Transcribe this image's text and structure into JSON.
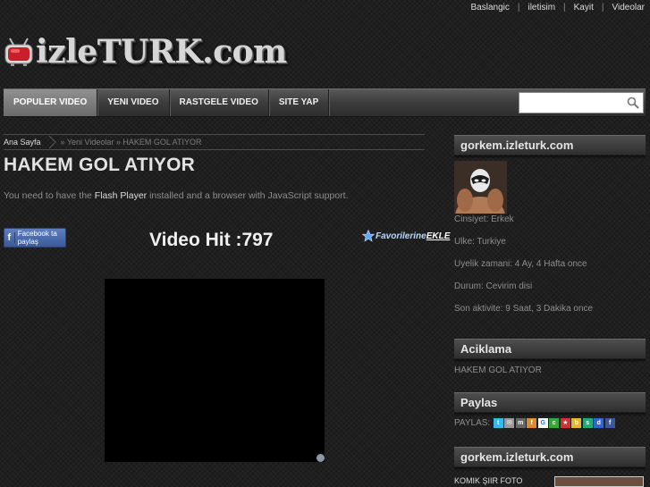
{
  "top_links": [
    "Baslangic",
    "iletisim",
    "Kayit",
    "Videolar"
  ],
  "brand": {
    "name": "izleTURK.com"
  },
  "nav": {
    "tabs": [
      {
        "label": "POPULER VIDEO",
        "active": true
      },
      {
        "label": "YENI VIDEO",
        "active": false
      },
      {
        "label": "RASTGELE VIDEO",
        "active": false
      },
      {
        "label": "SITE YAP",
        "active": false
      }
    ],
    "search_value": ""
  },
  "breadcrumb": {
    "home": "Ana Sayfa",
    "trail": "» Yeni Videolar » HAKEM GOL ATIYOR"
  },
  "page_title": "HAKEM GOL ATIYOR",
  "flash_note": {
    "before": "You need to have the ",
    "link": "Flash Player",
    "after": " installed and a browser with JavaScript support."
  },
  "facebook_button": {
    "icon_letter": "f",
    "label": "Facebook ta paylaş"
  },
  "video_hit": "Video Hit :797",
  "favorites": {
    "label": "Favorilerine ",
    "action": "EKLE"
  },
  "sidebar": {
    "profile_title": "gorkem.izleturk.com",
    "details": [
      "Cinsiyet: Erkek",
      "Ulke: Turkiye",
      "Uyelik zamani: 4 Ay, 4 Hafta once",
      "Durum: Cevirim disi",
      "Son aktivite: 9 Saat, 3 Dakika once"
    ],
    "aciklama_title": "Aciklama",
    "aciklama_text": "HAKEM GOL ATIYOR",
    "paylas_title": "Paylas",
    "paylas_label": "PAYLAS:",
    "share_icons": [
      {
        "name": "twitter-icon",
        "color": "#33bbee",
        "glyph": "t"
      },
      {
        "name": "email-icon",
        "color": "#9a9a9a",
        "glyph": "✉"
      },
      {
        "name": "myspace-icon",
        "color": "#666666",
        "glyph": "m"
      },
      {
        "name": "friendfeed-icon",
        "color": "#e08a2a",
        "glyph": "f"
      },
      {
        "name": "google-icon",
        "color": "#ffffff",
        "glyph": "G"
      },
      {
        "name": "chat-icon",
        "color": "#33aa33",
        "glyph": "c"
      },
      {
        "name": "multicolor-icon",
        "color": "#cc3333",
        "glyph": "★"
      },
      {
        "name": "bookmark-icon",
        "color": "#e6b830",
        "glyph": "b"
      },
      {
        "name": "stumble-icon",
        "color": "#22aa77",
        "glyph": "s"
      },
      {
        "name": "delicious-icon",
        "color": "#3366cc",
        "glyph": "d"
      },
      {
        "name": "facebook-icon",
        "color": "#3b5998",
        "glyph": "f"
      }
    ],
    "bottom_title": "gorkem.izleturk.com",
    "komik_label": "KOMIK ŞIIR FOTO"
  }
}
